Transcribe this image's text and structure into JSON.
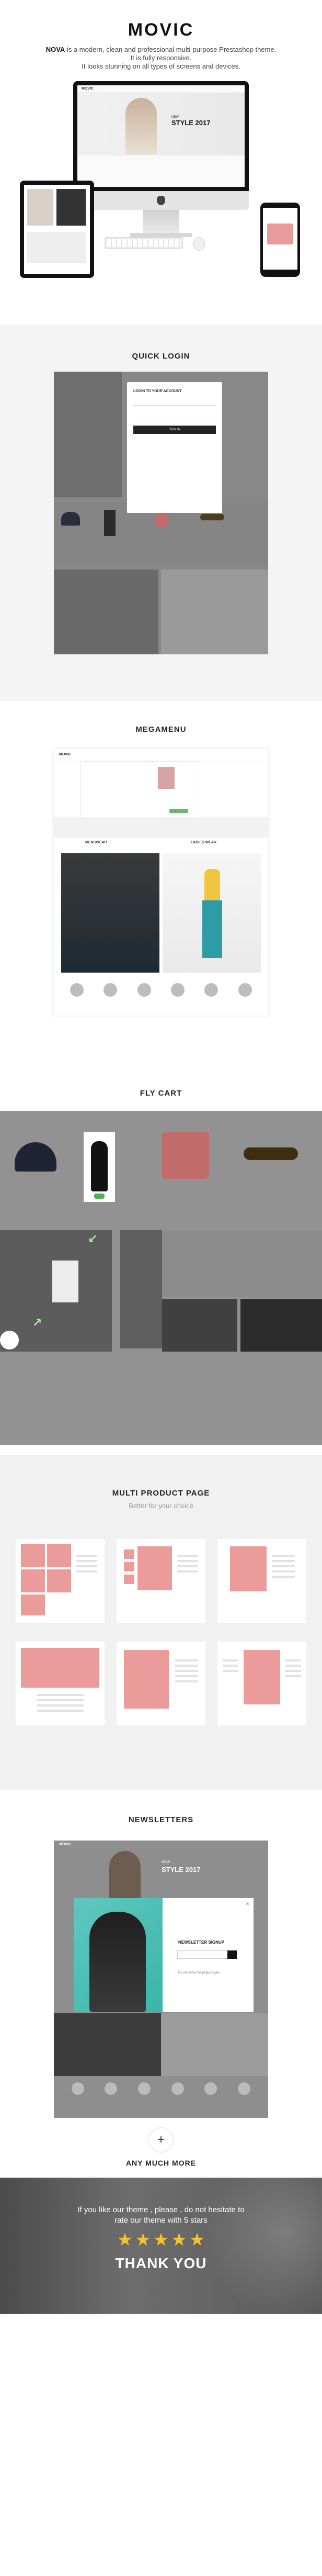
{
  "hero": {
    "brand": "MOVIC",
    "desc_brand": "NOVA",
    "desc_rest": " is a modern, clean and professional multi-purpose Prestashop theme.",
    "desc_line2": "It is fully responsive.",
    "desc_line3": "It looks stunning on all types of screens and devices.",
    "banner_small": "NEW",
    "banner_big": "STYLE 2017",
    "screen_logo": "MOVIC"
  },
  "quick_login": {
    "title": "QUICK LOGIN",
    "modal_title": "LOGIN TO YOUR ACCOUNT",
    "sign_in": "SIGN IN"
  },
  "megamenu": {
    "title": "MEGAMENU",
    "logo": "MOVIC",
    "caption_left": "MENSWEAR",
    "caption_right": "LADIES WEAR"
  },
  "fly_cart": {
    "title": "FLY CART"
  },
  "multi_product": {
    "title": "MULTI PRODUCT PAGE",
    "subtitle": "Better for your choice"
  },
  "newsletters": {
    "title": "NEWSLETTERS",
    "logo": "MOVIC",
    "banner_small": "NEW",
    "banner_big": "STYLE 2017",
    "modal_title": "NEWSLETTER SIGNUP",
    "modal_note": "Do not show this popup again"
  },
  "more": {
    "plus": "+",
    "label": "ANY MUCH MORE"
  },
  "thanks": {
    "line1": "If you like our theme , please , do not hesitate to",
    "line2": "rate our theme with 5 stars",
    "stars": 5,
    "title": "THANK YOU",
    "star_color": "#f2c230"
  },
  "colors": {
    "accent_pink": "#ec9b9b",
    "accent_green": "#66bb6a",
    "overlay_gray": "#888888"
  }
}
